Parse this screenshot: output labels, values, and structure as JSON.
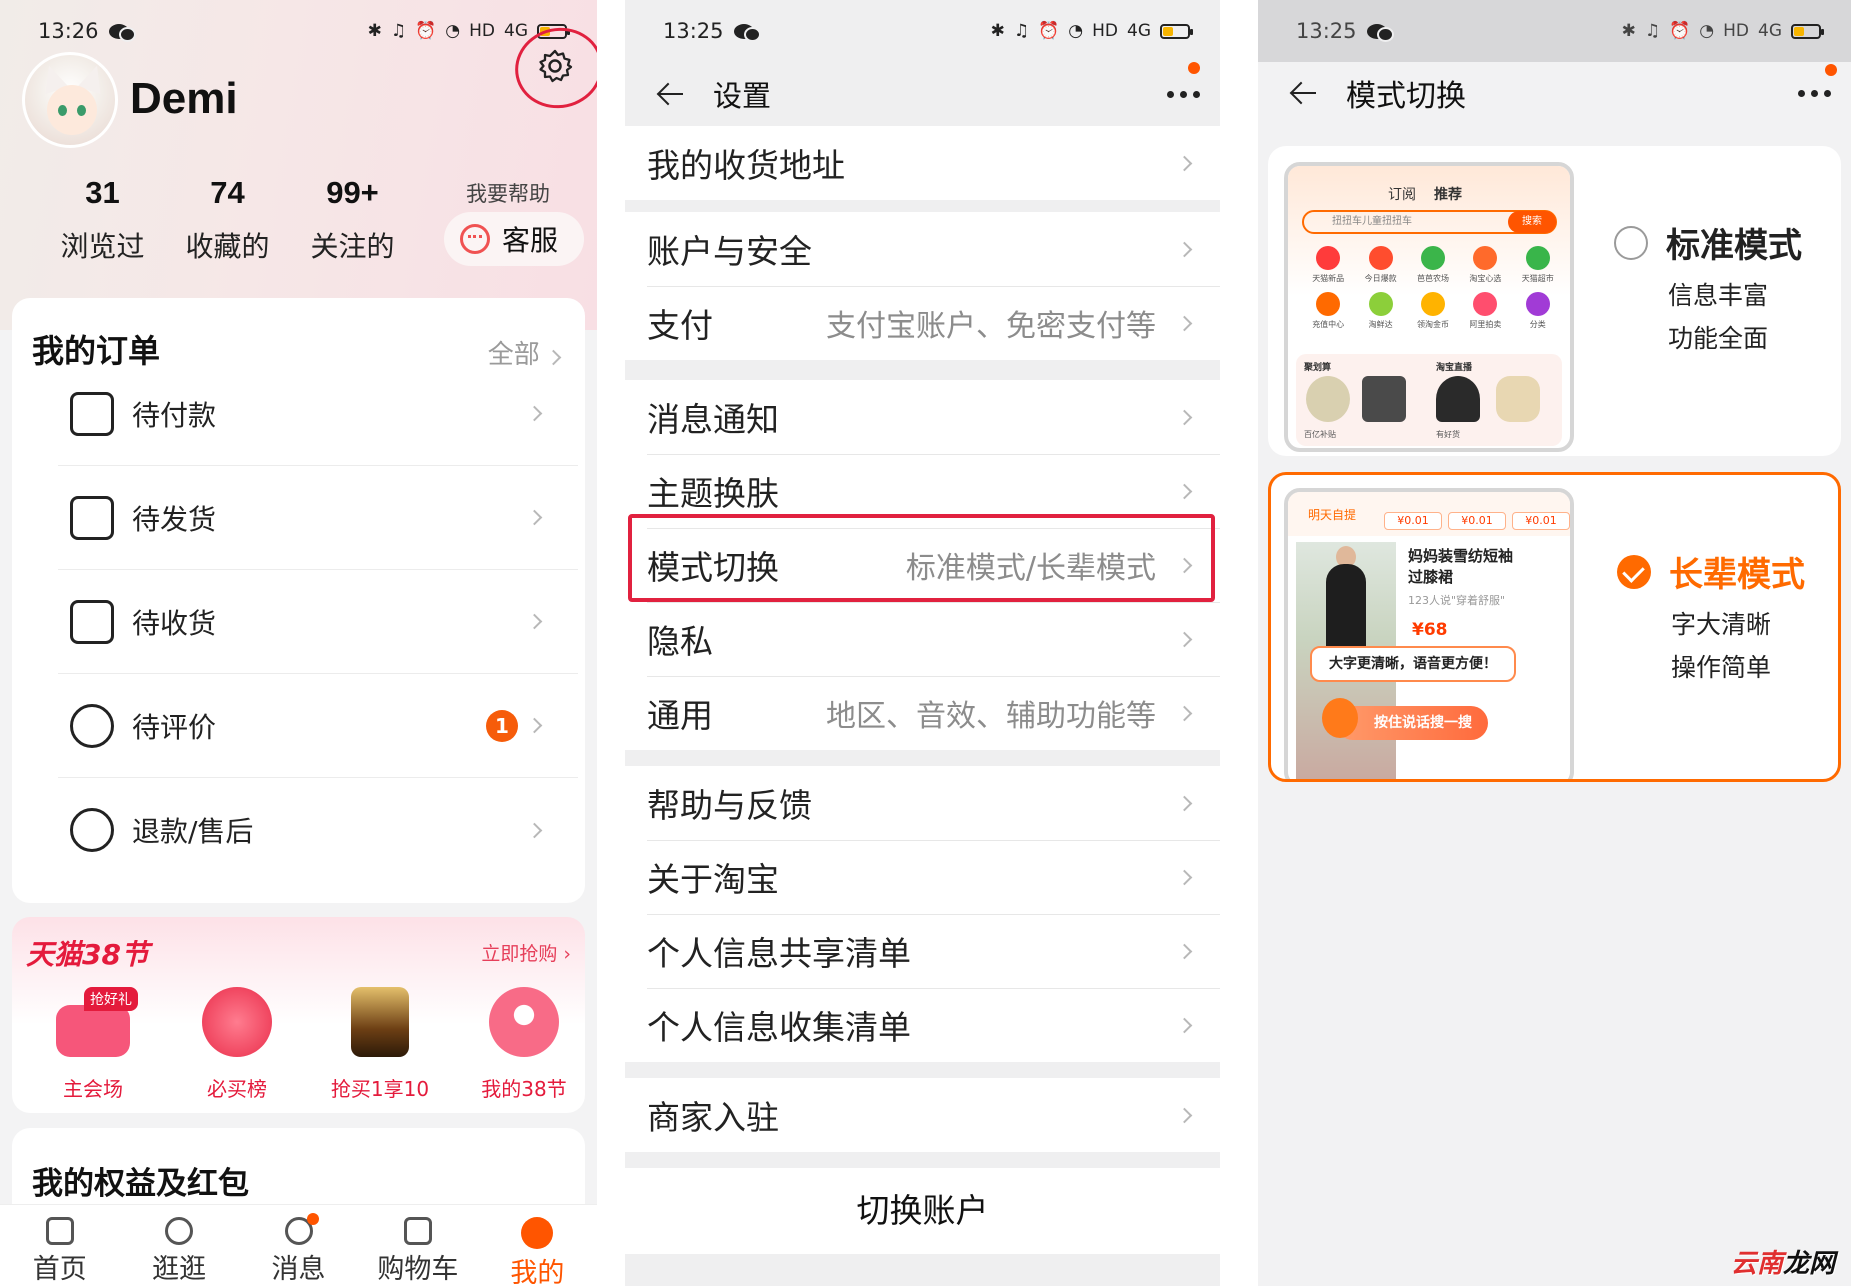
{
  "panel1": {
    "status": {
      "time": "13:26",
      "hd": "HD",
      "signal": "4G"
    },
    "user": {
      "name": "Demi"
    },
    "stats": [
      {
        "num": "31",
        "label": "浏览过"
      },
      {
        "num": "74",
        "label": "收藏的"
      },
      {
        "num": "99+",
        "label": "关注的"
      }
    ],
    "help_label": "我要帮助",
    "customer_service": "客服",
    "orders": {
      "title": "我的订单",
      "all": "全部",
      "items": [
        {
          "label": "待付款",
          "icon": "wallet-icon"
        },
        {
          "label": "待发货",
          "icon": "package-icon"
        },
        {
          "label": "待收货",
          "icon": "truck-icon"
        },
        {
          "label": "待评价",
          "icon": "comment-icon",
          "badge": "1"
        },
        {
          "label": "退款/售后",
          "icon": "refund-icon"
        }
      ]
    },
    "promo": {
      "title": "天猫38节",
      "more": "立即抢购",
      "tag": "抢好礼",
      "items": [
        {
          "label": "主会场",
          "color": "#f6567a"
        },
        {
          "label": "必买榜",
          "color": "#f0455f"
        },
        {
          "label": "抢买1享10",
          "color": "#c58a2e"
        },
        {
          "label": "我的38节",
          "color": "#f86b87"
        }
      ]
    },
    "benefits_title": "我的权益及红包",
    "tabs": [
      {
        "label": "首页",
        "icon": "home-icon"
      },
      {
        "label": "逛逛",
        "icon": "explore-icon"
      },
      {
        "label": "消息",
        "icon": "message-icon"
      },
      {
        "label": "购物车",
        "icon": "cart-icon"
      },
      {
        "label": "我的",
        "icon": "me-icon",
        "active": true
      }
    ],
    "accent": "#ff5500",
    "highlight_color": "#e1213f"
  },
  "panel2": {
    "status": {
      "time": "13:25",
      "hd": "HD",
      "signal": "4G"
    },
    "title": "设置",
    "groups": [
      [
        {
          "label": "我的收货地址",
          "value": ""
        }
      ],
      [
        {
          "label": "账户与安全",
          "value": ""
        },
        {
          "label": "支付",
          "value": "支付宝账户、免密支付等"
        }
      ],
      [
        {
          "label": "消息通知",
          "value": ""
        },
        {
          "label": "主题换肤",
          "value": ""
        },
        {
          "label": "模式切换",
          "value": "标准模式/长辈模式"
        },
        {
          "label": "隐私",
          "value": ""
        },
        {
          "label": "通用",
          "value": "地区、音效、辅助功能等"
        }
      ],
      [
        {
          "label": "帮助与反馈",
          "value": ""
        },
        {
          "label": "关于淘宝",
          "value": ""
        },
        {
          "label": "个人信息共享清单",
          "value": ""
        },
        {
          "label": "个人信息收集清单",
          "value": ""
        }
      ],
      [
        {
          "label": "商家入驻",
          "value": ""
        }
      ]
    ],
    "switch_account": "切换账户"
  },
  "panel3": {
    "status": {
      "time": "13:25",
      "hd": "HD",
      "signal": "4G"
    },
    "title": "模式切换",
    "standard": {
      "name": "标准模式",
      "desc": [
        "信息丰富",
        "功能全面"
      ],
      "selected": false,
      "preview": {
        "tabs": [
          "订阅",
          "推荐"
        ],
        "search_placeholder": "扭扭车儿童扭扭车",
        "search_button": "搜索",
        "grid": [
          "天猫新品",
          "今日爆款",
          "芭芭农场",
          "淘宝心选",
          "天猫超市",
          "充值中心",
          "淘鲜达",
          "领淘金币",
          "阿里拍卖",
          "分类"
        ],
        "bottom": [
          "聚划算",
          "淘宝直播",
          "百亿补贴",
          "有好货"
        ]
      }
    },
    "elder": {
      "name": "长辈模式",
      "desc": [
        "字大清晰",
        "操作简单"
      ],
      "selected": true,
      "preview": {
        "top_label": "明天自提",
        "prices": [
          "¥0.01",
          "¥0.01",
          "¥0.01"
        ],
        "product_title": "妈妈装雪纺短袖过膝裙",
        "product_sub": "123人说\"穿着舒服\"",
        "product_price": "¥68",
        "bubble": "大字更清晰，语音更方便！",
        "voice": "按住说话搜一搜"
      }
    }
  },
  "watermark": {
    "a": "云南",
    "b": "龙网"
  }
}
